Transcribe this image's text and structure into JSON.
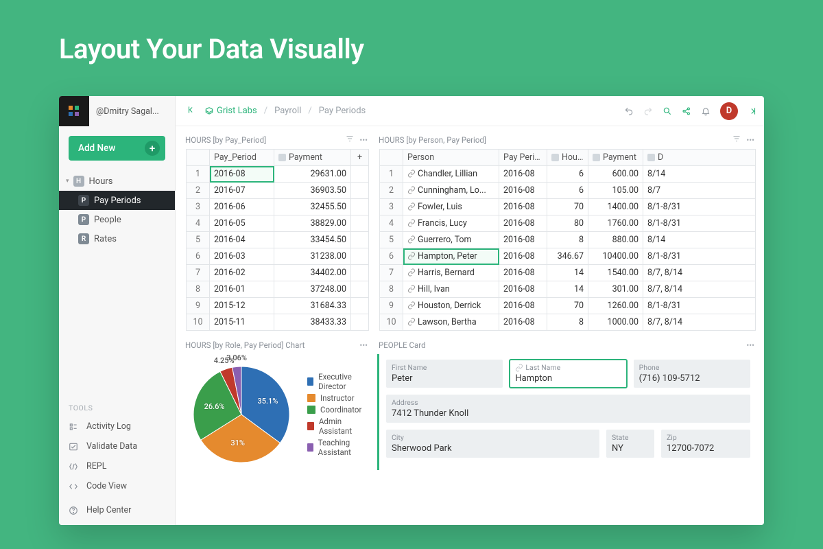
{
  "hero": {
    "title": "Layout Your Data Visually"
  },
  "user": {
    "display": "@Dmitry Sagal...",
    "avatar_letter": "D"
  },
  "breadcrumb": {
    "home": "Grist Labs",
    "parts": [
      "Payroll",
      "Pay Periods"
    ]
  },
  "sidebar": {
    "add_label": "Add New",
    "nav": {
      "parent_label": "Hours",
      "parent_badge": "H",
      "children": [
        {
          "badge": "P",
          "label": "Pay Periods",
          "active": true
        },
        {
          "badge": "P",
          "label": "People",
          "active": false
        },
        {
          "badge": "R",
          "label": "Rates",
          "active": false
        }
      ]
    },
    "tools_label": "TOOLS",
    "tools": [
      {
        "icon": "activity",
        "label": "Activity Log"
      },
      {
        "icon": "validate",
        "label": "Validate Data"
      },
      {
        "icon": "repl",
        "label": "REPL"
      },
      {
        "icon": "code",
        "label": "Code View"
      }
    ],
    "help_label": "Help Center"
  },
  "panels": {
    "left_table": {
      "title": "HOURS [by Pay_Period]",
      "columns": [
        "Pay_Period",
        "Payment"
      ],
      "rows": [
        {
          "n": 1,
          "period": "2016-08",
          "payment": "29631.00",
          "sel": true
        },
        {
          "n": 2,
          "period": "2016-07",
          "payment": "36903.50"
        },
        {
          "n": 3,
          "period": "2016-06",
          "payment": "32455.50"
        },
        {
          "n": 4,
          "period": "2016-05",
          "payment": "38829.00"
        },
        {
          "n": 5,
          "period": "2016-04",
          "payment": "33454.50"
        },
        {
          "n": 6,
          "period": "2016-03",
          "payment": "31238.00"
        },
        {
          "n": 7,
          "period": "2016-02",
          "payment": "34402.00"
        },
        {
          "n": 8,
          "period": "2016-01",
          "payment": "37248.00"
        },
        {
          "n": 9,
          "period": "2015-12",
          "payment": "31684.33"
        },
        {
          "n": 10,
          "period": "2015-11",
          "payment": "38433.33"
        }
      ]
    },
    "right_table": {
      "title": "HOURS [by Person, Pay Period]",
      "columns": [
        "Person",
        "Pay Period",
        "Hours",
        "Payment",
        "D"
      ],
      "rows": [
        {
          "n": 1,
          "person": "Chandler, Lillian",
          "period": "2016-08",
          "hours": "6",
          "payment": "600.00",
          "d": "8/14"
        },
        {
          "n": 2,
          "person": "Cunningham, Lo...",
          "period": "2016-08",
          "hours": "6",
          "payment": "105.00",
          "d": "8/7"
        },
        {
          "n": 3,
          "person": "Fowler, Luis",
          "period": "2016-08",
          "hours": "70",
          "payment": "1400.00",
          "d": "8/1-8/31"
        },
        {
          "n": 4,
          "person": "Francis, Lucy",
          "period": "2016-08",
          "hours": "80",
          "payment": "1760.00",
          "d": "8/1-8/31"
        },
        {
          "n": 5,
          "person": "Guerrero, Tom",
          "period": "2016-08",
          "hours": "8",
          "payment": "880.00",
          "d": "8/14"
        },
        {
          "n": 6,
          "person": "Hampton, Peter",
          "period": "2016-08",
          "hours": "346.67",
          "payment": "10400.00",
          "d": "8/1-8/31",
          "sel": true
        },
        {
          "n": 7,
          "person": "Harris, Bernard",
          "period": "2016-08",
          "hours": "14",
          "payment": "1540.00",
          "d": "8/7, 8/14"
        },
        {
          "n": 8,
          "person": "Hill, Ivan",
          "period": "2016-08",
          "hours": "14",
          "payment": "301.00",
          "d": "8/7, 8/14"
        },
        {
          "n": 9,
          "person": "Houston, Derrick",
          "period": "2016-08",
          "hours": "70",
          "payment": "1260.00",
          "d": "8/1-8/31"
        },
        {
          "n": 10,
          "person": "Lawson, Bertha",
          "period": "2016-08",
          "hours": "8",
          "payment": "1000.00",
          "d": "8/7, 8/14"
        }
      ]
    },
    "chart": {
      "title": "HOURS [by Role, Pay Period] Chart"
    },
    "card": {
      "title": "PEOPLE Card",
      "fields": {
        "first_name": {
          "label": "First Name",
          "value": "Peter"
        },
        "last_name": {
          "label": "Last Name",
          "value": "Hampton",
          "sel": true
        },
        "phone": {
          "label": "Phone",
          "value": "(716) 109-5712"
        },
        "address": {
          "label": "Address",
          "value": "7412 Thunder Knoll"
        },
        "city": {
          "label": "City",
          "value": "Sherwood Park"
        },
        "state": {
          "label": "State",
          "value": "NY"
        },
        "zip": {
          "label": "Zip",
          "value": "12700-7072"
        }
      }
    }
  },
  "chart_data": {
    "type": "pie",
    "title": "HOURS [by Role, Pay Period] Chart",
    "series": [
      {
        "name": "Executive Director",
        "value": 35.1,
        "color": "#2e6fb4",
        "label": "35.1%"
      },
      {
        "name": "Instructor",
        "value": 31.0,
        "color": "#e58a2e",
        "label": "31%"
      },
      {
        "name": "Coordinator",
        "value": 26.6,
        "color": "#3a9e4b",
        "label": "26.6%"
      },
      {
        "name": "Admin Assistant",
        "value": 4.25,
        "color": "#c0392b",
        "label": "4.25%"
      },
      {
        "name": "Teaching Assistant",
        "value": 3.06,
        "color": "#8a5fb0",
        "label": "3.06%"
      }
    ]
  },
  "colors": {
    "accent": "#2cb47b"
  }
}
